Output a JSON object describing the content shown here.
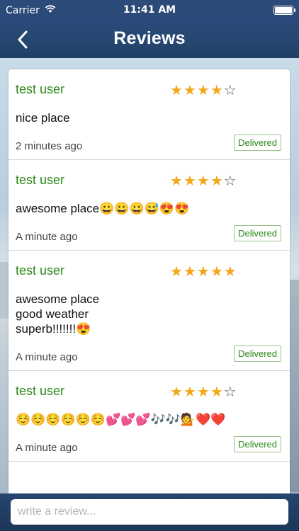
{
  "status": {
    "carrier": "Carrier",
    "time": "11:41 AM"
  },
  "nav": {
    "title": "Reviews"
  },
  "reviews": [
    {
      "user": "test user",
      "rating": 4,
      "max": 5,
      "text": "nice place",
      "time": "2 minutes ago",
      "status": "Delivered"
    },
    {
      "user": "test user",
      "rating": 4,
      "max": 5,
      "text": "awesome place😀😀😀😅😍😍",
      "time": "A minute ago",
      "status": "Delivered"
    },
    {
      "user": "test user",
      "rating": 5,
      "max": 5,
      "text": "awesome place\ngood weather\nsuperb!!!!!!!😍",
      "time": "A minute ago",
      "status": "Delivered"
    },
    {
      "user": "test user",
      "rating": 4,
      "max": 5,
      "text": "☺️☺️☺️☺️☺️☺️💕💕💕🎶🎶💁❤️❤️",
      "time": "A minute ago",
      "status": "Delivered"
    }
  ],
  "composer": {
    "placeholder": "write a review..."
  }
}
